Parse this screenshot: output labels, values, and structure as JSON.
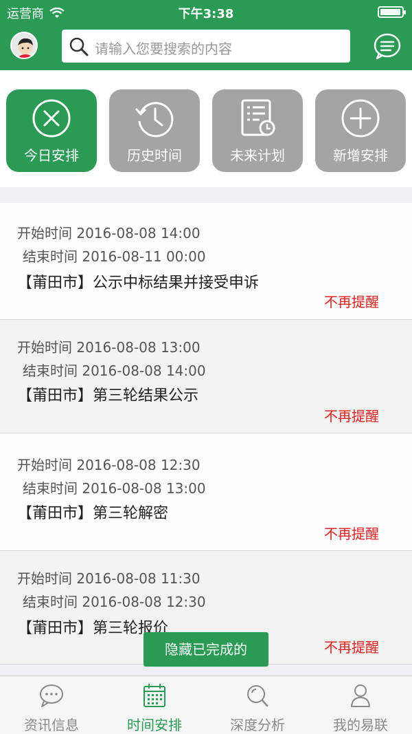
{
  "status_bar": {
    "carrier": "运营商",
    "time": "下午3:38",
    "battery_level": 0.95
  },
  "header": {
    "search_placeholder": "请输入您要搜索的内容",
    "icons": [
      "avatar",
      "search-icon",
      "message-icon"
    ]
  },
  "segments": [
    {
      "label": "今日安排",
      "icon": "close-circle-icon",
      "active": true
    },
    {
      "label": "历史时间",
      "icon": "history-clock-icon",
      "active": false
    },
    {
      "label": "未来计划",
      "icon": "plan-list-icon",
      "active": false
    },
    {
      "label": "新增安排",
      "icon": "add-circle-icon",
      "active": false
    }
  ],
  "items": [
    {
      "start": "开始时间 2016-08-08 14:00",
      "end": "结束时间 2016-08-11 00:00",
      "title": "【莆田市】公示中标结果并接受申诉",
      "action": "不再提醒"
    },
    {
      "start": "开始时间 2016-08-08 13:00",
      "end": "结束时间 2016-08-08 14:00",
      "title": "【莆田市】第三轮结果公示",
      "action": "不再提醒"
    },
    {
      "start": "开始时间 2016-08-08 12:30",
      "end": "结束时间 2016-08-08 13:00",
      "title": "【莆田市】第三轮解密",
      "action": "不再提醒"
    },
    {
      "start": "开始时间 2016-08-08 11:30",
      "end": "结束时间 2016-08-08 12:30",
      "title": "【莆田市】第三轮报价",
      "action": "不再提醒"
    }
  ],
  "hide_completed_label": "隐藏已完成的",
  "tabbar": [
    {
      "label": "资讯信息",
      "icon": "chat-bubble-icon",
      "active": false
    },
    {
      "label": "时间安排",
      "icon": "calendar-icon",
      "active": true
    },
    {
      "label": "深度分析",
      "icon": "magnifier-icon",
      "active": false
    },
    {
      "label": "我的易联",
      "icon": "person-icon",
      "active": false
    }
  ],
  "colors": {
    "primary": "#2a9a55",
    "inactive": "#a4a4a4",
    "alert": "#e02020"
  }
}
